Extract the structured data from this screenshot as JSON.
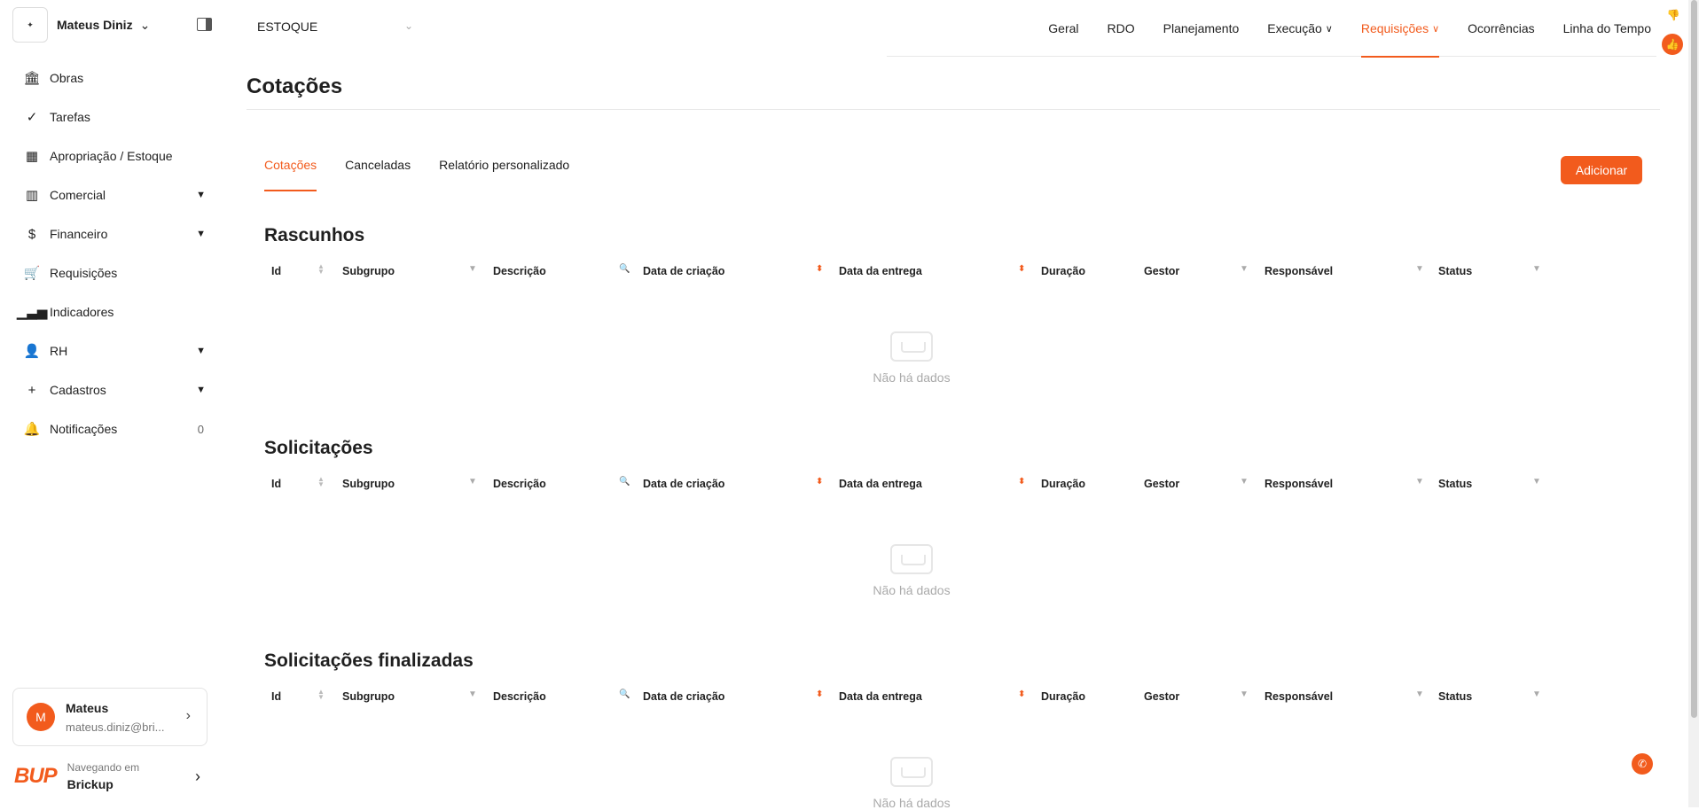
{
  "sidebar": {
    "user_name": "Mateus Diniz",
    "items": [
      {
        "label": "Obras",
        "icon": "bank-icon"
      },
      {
        "label": "Tarefas",
        "icon": "check-circle-icon"
      },
      {
        "label": "Apropriação / Estoque",
        "icon": "grid-icon"
      },
      {
        "label": "Comercial",
        "icon": "barcode-icon"
      },
      {
        "label": "Financeiro",
        "icon": "dollar-icon"
      },
      {
        "label": "Requisições",
        "icon": "cart-icon"
      },
      {
        "label": "Indicadores",
        "icon": "bar-chart-icon"
      },
      {
        "label": "RH",
        "icon": "user-icon"
      },
      {
        "label": "Cadastros",
        "icon": "plus-icon"
      },
      {
        "label": "Notificações",
        "icon": "bell-icon",
        "count": "0"
      }
    ],
    "user_card": {
      "initial": "M",
      "name": "Mateus",
      "email": "mateus.diniz@bri..."
    },
    "company": {
      "logo": "BUP",
      "label": "Navegando em",
      "name": "Brickup"
    }
  },
  "header": {
    "obra_select": "ESTOQUE",
    "tabs": [
      {
        "label": "Geral"
      },
      {
        "label": "RDO"
      },
      {
        "label": "Planejamento"
      },
      {
        "label": "Execução"
      },
      {
        "label": "Requisições"
      },
      {
        "label": "Ocorrências"
      },
      {
        "label": "Linha do Tempo"
      }
    ]
  },
  "main": {
    "title": "Cotações",
    "tabs": [
      "Cotações",
      "Canceladas",
      "Relatório personalizado"
    ],
    "add_label": "Adicionar",
    "columns": [
      "Id",
      "Subgrupo",
      "Descrição",
      "Data de criação",
      "Data da entrega",
      "Duração",
      "Gestor",
      "Responsável",
      "Status"
    ],
    "sections": [
      {
        "title": "Rascunhos",
        "empty": "Não há dados"
      },
      {
        "title": "Solicitações",
        "empty": "Não há dados"
      },
      {
        "title": "Solicitações finalizadas",
        "empty": "Não há dados"
      }
    ]
  },
  "colors": {
    "accent": "#f25b1d"
  }
}
